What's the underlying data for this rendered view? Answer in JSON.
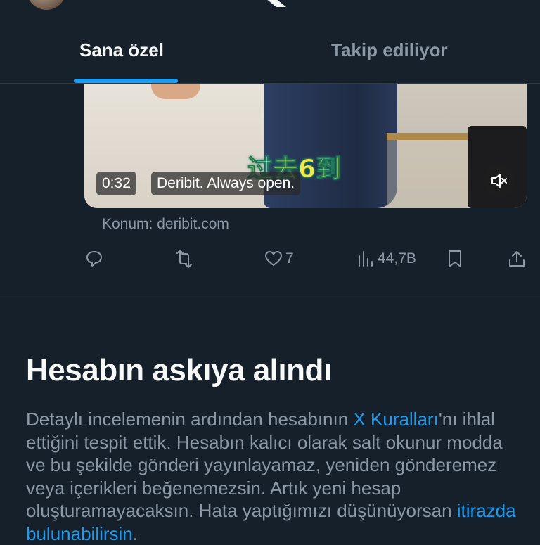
{
  "header": {
    "tabs": [
      {
        "label": "Sana özel",
        "active": true
      },
      {
        "label": "Takip ediliyor",
        "active": false
      }
    ],
    "accent_color": "#1d9bf0"
  },
  "post": {
    "media": {
      "subtitle_text": "过去6到",
      "duration": "0:32",
      "sponsor_text": "Deribit. Always open.",
      "mute_icon": "volume-muted-icon"
    },
    "location": "Konum: deribit.com",
    "actions": {
      "reply_icon": "reply-icon",
      "repost_icon": "repost-icon",
      "like_icon": "heart-icon",
      "like_count": "7",
      "views_icon": "views-chart-icon",
      "views_count": "44,7B",
      "bookmark_icon": "bookmark-icon",
      "share_icon": "share-icon"
    }
  },
  "notice": {
    "title": "Hesabın askıya alındı",
    "body_before_link": "Detaylı incelemenin ardından hesabının ",
    "rules_link": "X Kuralları",
    "body_middle": "'nı ihlal ettiğini tespit ettik. Hesabın kalıcı olarak salt okunur modda ve bu şekilde gönderi yayınlayamaz, yeniden gönderemez veya içerikleri beğenemezsin. Artık yeni hesap oluşturamayacaksın. Hata yaptığımızı düşünüyorsan ",
    "appeal_link": "itirazda bulunabilirsin",
    "body_after_link": "."
  }
}
